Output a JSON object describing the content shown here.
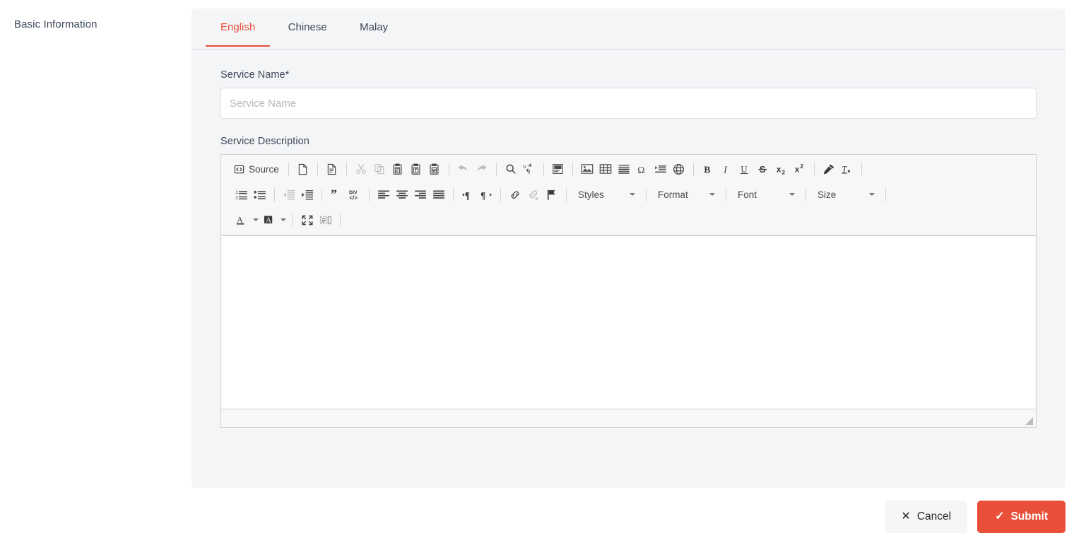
{
  "sidebar": {
    "title": "Basic Information"
  },
  "tabs": [
    {
      "label": "English",
      "active": true
    },
    {
      "label": "Chinese",
      "active": false
    },
    {
      "label": "Malay",
      "active": false
    }
  ],
  "form": {
    "service_name_label": "Service Name*",
    "service_name_value": "",
    "service_name_placeholder": "Service Name",
    "service_description_label": "Service Description"
  },
  "editor": {
    "content": "",
    "toolbar": {
      "source_label": "Source",
      "row1": [
        "source-button",
        "sep",
        "new-page-icon",
        "sep",
        "templates-icon",
        "sep",
        "cut-icon",
        "copy-icon",
        "paste-icon",
        "paste-text-icon",
        "paste-word-icon",
        "sep",
        "undo-icon",
        "redo-icon",
        "sep",
        "find-icon",
        "replace-icon",
        "sep",
        "select-all-icon",
        "sep",
        "image-icon",
        "table-icon",
        "horizontal-rule-icon",
        "special-char-icon",
        "page-break-icon",
        "iframe-icon",
        "sep",
        "bold-icon",
        "italic-icon",
        "underline-icon",
        "strike-icon",
        "subscript-icon",
        "superscript-icon",
        "sep",
        "copy-formatting-icon",
        "remove-format-icon",
        "sep"
      ],
      "row2": [
        "numbered-list-icon",
        "bulleted-list-icon",
        "sep",
        "outdent-icon",
        "indent-icon",
        "sep",
        "blockquote-icon",
        "div-container-icon",
        "sep",
        "align-left-icon",
        "align-center-icon",
        "align-right-icon",
        "align-justify-icon",
        "sep",
        "ltr-icon",
        "rtl-icon",
        "sep",
        "link-icon",
        "unlink-icon",
        "anchor-icon",
        "sep",
        "styles-combo",
        "sep",
        "format-combo",
        "sep",
        "font-combo",
        "sep",
        "size-combo",
        "sep"
      ],
      "row3": [
        "text-color-icon",
        "background-color-icon",
        "sep",
        "maximize-icon",
        "show-blocks-icon",
        "sep"
      ],
      "combos": {
        "styles": "Styles",
        "format": "Format",
        "font": "Font",
        "size": "Size"
      },
      "disabled": [
        "cut-icon",
        "copy-icon",
        "undo-icon",
        "redo-icon",
        "outdent-icon",
        "unlink-icon"
      ]
    }
  },
  "footer": {
    "cancel_label": "Cancel",
    "cancel_icon": "close-icon",
    "submit_label": "Submit",
    "submit_icon": "check-icon"
  },
  "colors": {
    "accent": "#e8503a",
    "panel_bg": "#f4f5f7",
    "toolbar_bg": "#f7f7f7",
    "text": "#3c4858",
    "icon": "#474747"
  }
}
